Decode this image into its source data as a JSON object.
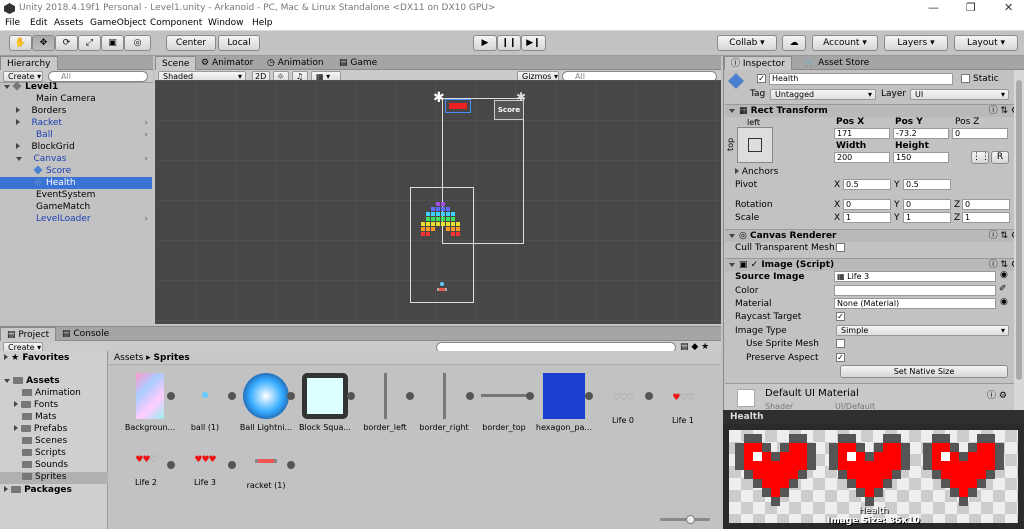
{
  "window": {
    "title": "Unity 2018.4.19f1 Personal - Level1.unity - Arkanoid - PC, Mac & Linux Standalone <DX11 on DX10 GPU>"
  },
  "menu": [
    "File",
    "Edit",
    "Assets",
    "GameObject",
    "Component",
    "Window",
    "Help"
  ],
  "toolbar": {
    "pivot": "Center",
    "space": "Local",
    "collab": "Collab",
    "account": "Account",
    "layers": "Layers",
    "layout": "Layout"
  },
  "hierarchy": {
    "tab": "Hierarchy",
    "create": "Create",
    "search": "All",
    "root": "Level1",
    "items": [
      {
        "label": "Main Camera"
      },
      {
        "label": "Borders"
      },
      {
        "label": "Racket"
      },
      {
        "label": "Ball"
      },
      {
        "label": "BlockGrid"
      },
      {
        "label": "Canvas"
      },
      {
        "label": "Score"
      },
      {
        "label": "Health"
      },
      {
        "label": "EventSystem"
      },
      {
        "label": "GameMatch"
      },
      {
        "label": "LevelLoader"
      }
    ]
  },
  "scene": {
    "tabs": [
      "Scene",
      "Animator",
      "Animation",
      "Game"
    ],
    "shading": "Shaded",
    "mode2d": "2D",
    "gizmos": "Gizmos",
    "search": "All",
    "score_label": "Score"
  },
  "inspector": {
    "tabs": [
      "Inspector",
      "Asset Store"
    ],
    "name": "Health",
    "static_label": "Static",
    "tag_label": "Tag",
    "tag_value": "Untagged",
    "layer_label": "Layer",
    "layer_value": "UI",
    "rect_transform": {
      "title": "Rect Transform",
      "anchor_h": "left",
      "anchor_v": "top",
      "posx_label": "Pos X",
      "posy_label": "Pos Y",
      "posz_label": "Pos Z",
      "posx": "171",
      "posy": "-73.2",
      "posz": "0",
      "width_label": "Width",
      "height_label": "Height",
      "width": "200",
      "height": "150",
      "r_button": "R",
      "anchors": "Anchors",
      "pivot_label": "Pivot",
      "pivot_x": "0.5",
      "pivot_y": "0.5",
      "rotation_label": "Rotation",
      "rot_x": "0",
      "rot_y": "0",
      "rot_z": "0",
      "scale_label": "Scale",
      "scale_x": "1",
      "scale_y": "1",
      "scale_z": "1",
      "x": "X",
      "y": "Y",
      "z": "Z"
    },
    "canvas_renderer": {
      "title": "Canvas Renderer",
      "cull_label": "Cull Transparent Mesh"
    },
    "image": {
      "title": "Image (Script)",
      "source_label": "Source Image",
      "source_value": "Life 3",
      "color_label": "Color",
      "material_label": "Material",
      "material_value": "None (Material)",
      "raycast_label": "Raycast Target",
      "type_label": "Image Type",
      "type_value": "Simple",
      "sprite_mesh_label": "Use Sprite Mesh",
      "preserve_label": "Preserve Aspect",
      "native_button": "Set Native Size"
    },
    "material": {
      "title": "Default UI Material",
      "shader_label": "Shader",
      "shader_value": "UI/Default"
    },
    "preview": {
      "title": "Health",
      "caption": "Health",
      "size": "Image Size: 35x10"
    }
  },
  "project": {
    "tabs": [
      "Project",
      "Console"
    ],
    "create": "Create",
    "favorites": "Favorites",
    "assets": "Assets",
    "folders": [
      "Animation",
      "Fonts",
      "Mats",
      "Prefabs",
      "Scenes",
      "Scripts",
      "Sounds",
      "Sprites"
    ],
    "packages": "Packages",
    "breadcrumb": [
      "Assets",
      "Sprites"
    ],
    "items": [
      {
        "label": "Backgroun..."
      },
      {
        "label": "ball (1)"
      },
      {
        "label": "Ball Lightni..."
      },
      {
        "label": "Block Squa..."
      },
      {
        "label": "border_left"
      },
      {
        "label": "border_right"
      },
      {
        "label": "border_top"
      },
      {
        "label": "hexagon_pa..."
      },
      {
        "label": "Life 0"
      },
      {
        "label": "Life 1"
      },
      {
        "label": "Life 2"
      },
      {
        "label": "Life 3"
      },
      {
        "label": "racket (1)"
      }
    ]
  },
  "colors": {
    "selection": "#3a72d6",
    "prefab_blue": "#1c3fb5",
    "heart_red": "#ff0000"
  }
}
